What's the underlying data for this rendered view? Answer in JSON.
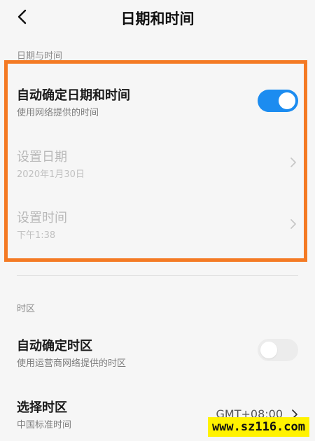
{
  "header": {
    "title": "日期和时间",
    "back_icon": "back-arrow-icon"
  },
  "sections": {
    "datetime_label": "日期与时间",
    "timezone_label": "时区"
  },
  "auto_datetime": {
    "title": "自动确定日期和时间",
    "subtitle": "使用网络提供的时间",
    "toggle_on": true
  },
  "set_date": {
    "title": "设置日期",
    "value": "2020年1月30日",
    "disabled": true
  },
  "set_time": {
    "title": "设置时间",
    "value": "下午1:38",
    "disabled": true
  },
  "auto_timezone": {
    "title": "自动确定时区",
    "subtitle": "使用运营商网络提供的时区",
    "toggle_on": false
  },
  "select_timezone": {
    "title": "选择时区",
    "subtitle": "中国标准时间",
    "value": "GMT+08:00"
  },
  "colors": {
    "accent": "#1c8cf0",
    "highlight": "#f47a24",
    "watermark_bg": "#fff200"
  },
  "watermark": "www.sz116.com"
}
